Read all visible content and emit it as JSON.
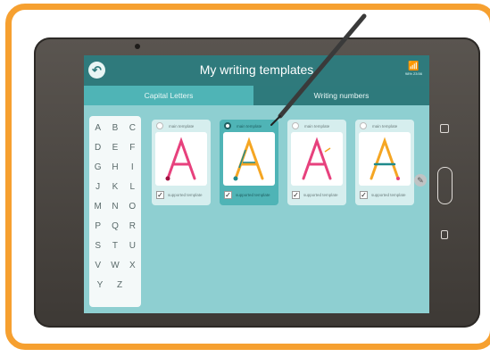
{
  "colors": {
    "frame_border": "#f6a030",
    "topbar": "#2f7a7c",
    "active_tab": "#4fb4b6",
    "inactive_tab": "#2e7a7c",
    "screen_bg": "#8ecfd1",
    "stroke_pink": "#e7417d",
    "stroke_orange": "#f5a623",
    "arrow_teal": "#1f8a8c"
  },
  "header": {
    "title": "My writing templates",
    "back_icon": "back-arrow-icon",
    "status_icon": "wifi-icon",
    "status_text": "98% 23:56"
  },
  "tabs": [
    {
      "label": "Capital Letters",
      "active": true
    },
    {
      "label": "Writing numbers",
      "active": false
    }
  ],
  "letters": [
    [
      "A",
      "B",
      "C"
    ],
    [
      "D",
      "E",
      "F"
    ],
    [
      "G",
      "H",
      "I"
    ],
    [
      "J",
      "K",
      "L"
    ],
    [
      "M",
      "N",
      "O"
    ],
    [
      "P",
      "Q",
      "R"
    ],
    [
      "S",
      "T",
      "U"
    ],
    [
      "V",
      "W",
      "X"
    ],
    [
      "Y",
      "Z"
    ]
  ],
  "templates": [
    {
      "radio_label": "main template",
      "check_label": "supported template",
      "letter": "A",
      "selected": false,
      "checked": true
    },
    {
      "radio_label": "main template",
      "check_label": "supported template",
      "letter": "A",
      "selected": true,
      "checked": true
    },
    {
      "radio_label": "main template",
      "check_label": "supported template",
      "letter": "A",
      "selected": false,
      "checked": true
    },
    {
      "radio_label": "main template",
      "check_label": "supported template",
      "letter": "A",
      "selected": false,
      "checked": true
    }
  ],
  "overlay_icons": [
    "stylus-icon",
    "pencil-icon"
  ]
}
